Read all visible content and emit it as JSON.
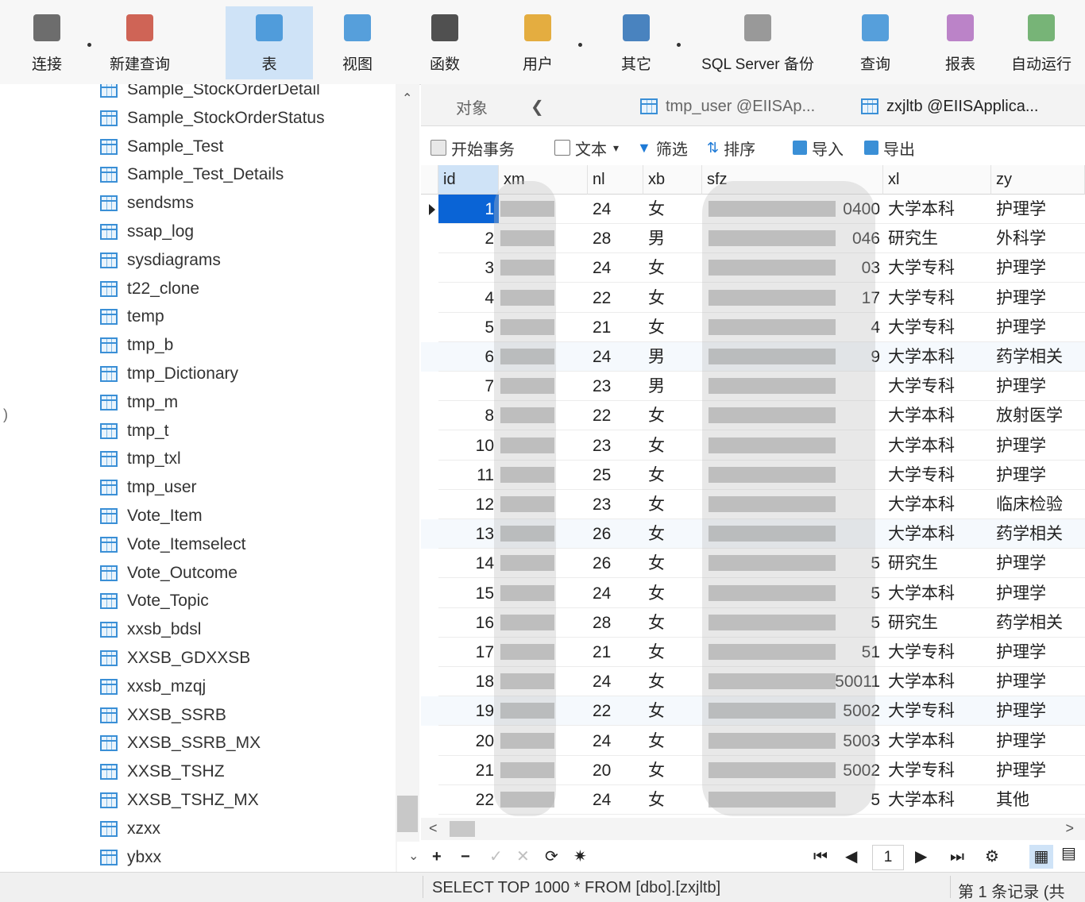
{
  "toolbar": {
    "buttons": [
      {
        "label": "连接",
        "icon": "plug-connect-icon"
      },
      {
        "label": "新建查询",
        "icon": "new-query-icon"
      },
      {
        "label": "表",
        "icon": "table-icon",
        "active": true
      },
      {
        "label": "视图",
        "icon": "view-icon"
      },
      {
        "label": "函数",
        "icon": "function-icon"
      },
      {
        "label": "用户",
        "icon": "user-icon"
      },
      {
        "label": "其它",
        "icon": "other-tools-icon"
      },
      {
        "label": "SQL Server 备份",
        "icon": "backup-icon"
      },
      {
        "label": "查询",
        "icon": "query-icon"
      },
      {
        "label": "报表",
        "icon": "report-icon"
      },
      {
        "label": "自动运行",
        "icon": "auto-run-icon"
      }
    ]
  },
  "tree": {
    "items": [
      "Sample_StockOrderDetail",
      "Sample_StockOrderStatus",
      "Sample_Test",
      "Sample_Test_Details",
      "sendsms",
      "ssap_log",
      "sysdiagrams",
      "t22_clone",
      "temp",
      "tmp_b",
      "tmp_Dictionary",
      "tmp_m",
      "tmp_t",
      "tmp_txl",
      "tmp_user",
      "Vote_Item",
      "Vote_Itemselect",
      "Vote_Outcome",
      "Vote_Topic",
      "xxsb_bdsl",
      "XXSB_GDXXSB",
      "xxsb_mzqj",
      "XXSB_SSRB",
      "XXSB_SSRB_MX",
      "XXSB_TSHZ",
      "XXSB_TSHZ_MX",
      "xzxx",
      "ybxx"
    ]
  },
  "tabs": {
    "objects": "对象",
    "tab1": "tmp_user @EIISAp...",
    "tab2": "zxjltb @EIISApplica..."
  },
  "subtoolbar": {
    "begin_transaction": "开始事务",
    "text": "文本",
    "filter": "筛选",
    "sort": "排序",
    "import": "导入",
    "export": "导出"
  },
  "grid": {
    "columns": [
      "id",
      "xm",
      "nl",
      "xb",
      "sfz",
      "xl",
      "zy"
    ],
    "rows": [
      {
        "id": "1",
        "nl": "24",
        "xb": "女",
        "sfz": "0400",
        "xl": "大学本科",
        "zy": "护理学"
      },
      {
        "id": "2",
        "nl": "28",
        "xb": "男",
        "sfz": "046",
        "xl": "研究生",
        "zy": "外科学"
      },
      {
        "id": "3",
        "nl": "24",
        "xb": "女",
        "sfz": "03",
        "xl": "大学专科",
        "zy": "护理学"
      },
      {
        "id": "4",
        "nl": "22",
        "xb": "女",
        "sfz": "17",
        "xl": "大学专科",
        "zy": "护理学"
      },
      {
        "id": "5",
        "nl": "21",
        "xb": "女",
        "sfz": "4",
        "xl": "大学专科",
        "zy": "护理学"
      },
      {
        "id": "6",
        "nl": "24",
        "xb": "男",
        "sfz": "9",
        "xl": "大学本科",
        "zy": "药学相关"
      },
      {
        "id": "7",
        "nl": "23",
        "xb": "男",
        "sfz": "",
        "xl": "大学专科",
        "zy": "护理学"
      },
      {
        "id": "8",
        "nl": "22",
        "xb": "女",
        "sfz": "",
        "xl": "大学本科",
        "zy": "放射医学"
      },
      {
        "id": "10",
        "nl": "23",
        "xb": "女",
        "sfz": "",
        "xl": "大学本科",
        "zy": "护理学"
      },
      {
        "id": "11",
        "nl": "25",
        "xb": "女",
        "sfz": "",
        "xl": "大学专科",
        "zy": "护理学"
      },
      {
        "id": "12",
        "nl": "23",
        "xb": "女",
        "sfz": "",
        "xl": "大学本科",
        "zy": "临床检验"
      },
      {
        "id": "13",
        "nl": "26",
        "xb": "女",
        "sfz": "",
        "xl": "大学本科",
        "zy": "药学相关"
      },
      {
        "id": "14",
        "nl": "26",
        "xb": "女",
        "sfz": "5",
        "xl": "研究生",
        "zy": "护理学"
      },
      {
        "id": "15",
        "nl": "24",
        "xb": "女",
        "sfz": "5",
        "xl": "大学本科",
        "zy": "护理学"
      },
      {
        "id": "16",
        "nl": "28",
        "xb": "女",
        "sfz": "5",
        "xl": "研究生",
        "zy": "药学相关"
      },
      {
        "id": "17",
        "nl": "21",
        "xb": "女",
        "sfz": "51",
        "xl": "大学专科",
        "zy": "护理学"
      },
      {
        "id": "18",
        "nl": "24",
        "xb": "女",
        "sfz": "50011",
        "xl": "大学本科",
        "zy": "护理学"
      },
      {
        "id": "19",
        "nl": "22",
        "xb": "女",
        "sfz": "5002",
        "xl": "大学专科",
        "zy": "护理学"
      },
      {
        "id": "20",
        "nl": "24",
        "xb": "女",
        "sfz": "5003",
        "xl": "大学本科",
        "zy": "护理学"
      },
      {
        "id": "21",
        "nl": "20",
        "xb": "女",
        "sfz": "5002",
        "xl": "大学专科",
        "zy": "护理学"
      },
      {
        "id": "22",
        "nl": "24",
        "xb": "女",
        "sfz": "5",
        "xl": "大学本科",
        "zy": "其他"
      }
    ]
  },
  "navigation": {
    "page": "1"
  },
  "status": {
    "sql": "SELECT TOP 1000 * FROM [dbo].[zxjltb]",
    "record": "第 1 条记录 (共"
  },
  "colors": {
    "accent": "#0a64d6",
    "table_icon": "#3a8fd6",
    "active_tab_bg": "#cfe3f7"
  }
}
